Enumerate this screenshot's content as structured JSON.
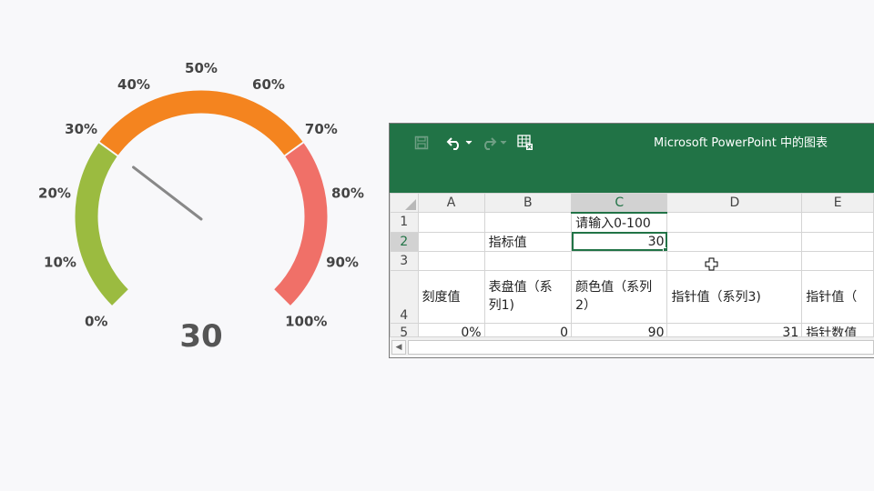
{
  "gauge": {
    "value": 30,
    "value_display": "30",
    "min": 0,
    "max": 100,
    "tick_labels": [
      "0%",
      "10%",
      "20%",
      "30%",
      "40%",
      "50%",
      "60%",
      "70%",
      "80%",
      "90%",
      "100%"
    ],
    "bands": [
      {
        "from": 0,
        "to": 30,
        "color": "#9bbb40"
      },
      {
        "from": 30,
        "to": 70,
        "color": "#f4841f"
      },
      {
        "from": 70,
        "to": 100,
        "color": "#f07068"
      }
    ],
    "needle_color": "#888888"
  },
  "excel": {
    "window_title": "Microsoft PowerPoint 中的图表",
    "accent_color": "#217346",
    "toolbar_icons": [
      "save-icon",
      "undo-icon",
      "undo-dropdown-icon",
      "redo-icon",
      "redo-dropdown-icon",
      "edit-data-icon"
    ],
    "columns": [
      "A",
      "B",
      "C",
      "D",
      "E"
    ],
    "active_column": "C",
    "active_row": "2",
    "rows": [
      {
        "num": "1",
        "cells": [
          "",
          "",
          "请输入0-100",
          "",
          ""
        ]
      },
      {
        "num": "2",
        "cells": [
          "",
          "指标值",
          "30",
          "",
          ""
        ]
      },
      {
        "num": "3",
        "cells": [
          "",
          "",
          "",
          "",
          ""
        ]
      },
      {
        "num": "4",
        "cells": [
          "刻度值",
          "表盘值（系列1)",
          "颜色值（系列 2）",
          "指针值（系列3)",
          "指针值（"
        ]
      },
      {
        "num": "5",
        "cells": [
          "0%",
          "0",
          "90",
          "31",
          "指针数值"
        ]
      }
    ]
  }
}
